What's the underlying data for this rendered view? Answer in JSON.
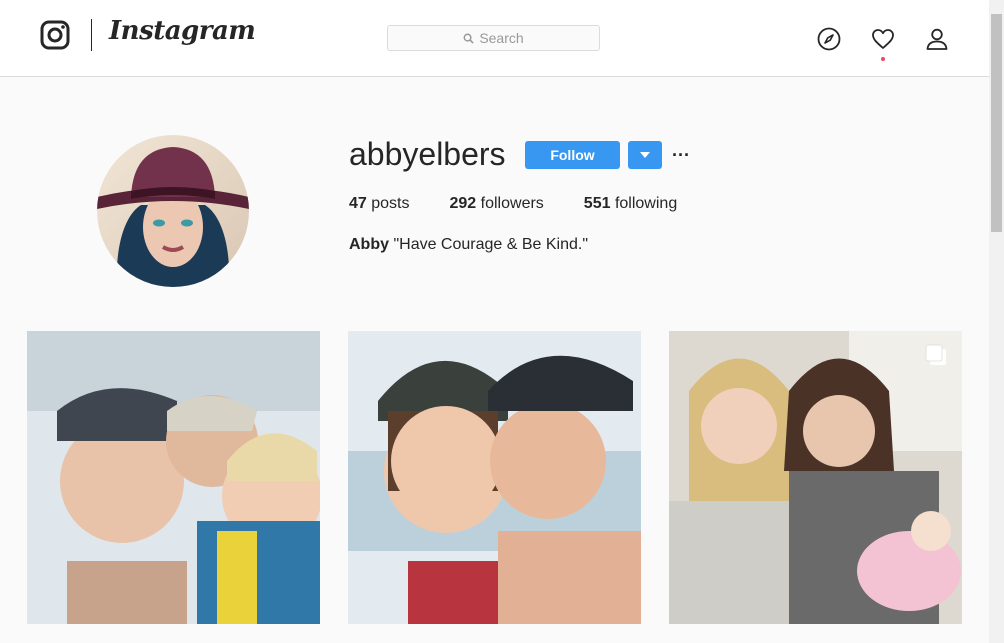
{
  "header": {
    "logo_text": "Instagram",
    "search_placeholder": "Search",
    "icons": [
      "instagram-camera-icon",
      "search-icon",
      "compass-icon",
      "heart-icon",
      "user-icon"
    ]
  },
  "profile": {
    "username": "abbyelbers",
    "follow_label": "Follow",
    "more_label": "···",
    "stats": {
      "posts_count": "47",
      "posts_label": "posts",
      "followers_count": "292",
      "followers_label": "followers",
      "following_count": "551",
      "following_label": "following"
    },
    "bio_name": "Abby",
    "bio_text": "\"Have Courage & Be Kind.\""
  },
  "colors": {
    "accent": "#3897f0",
    "background": "#fafafa",
    "notification": "#ed4956"
  }
}
